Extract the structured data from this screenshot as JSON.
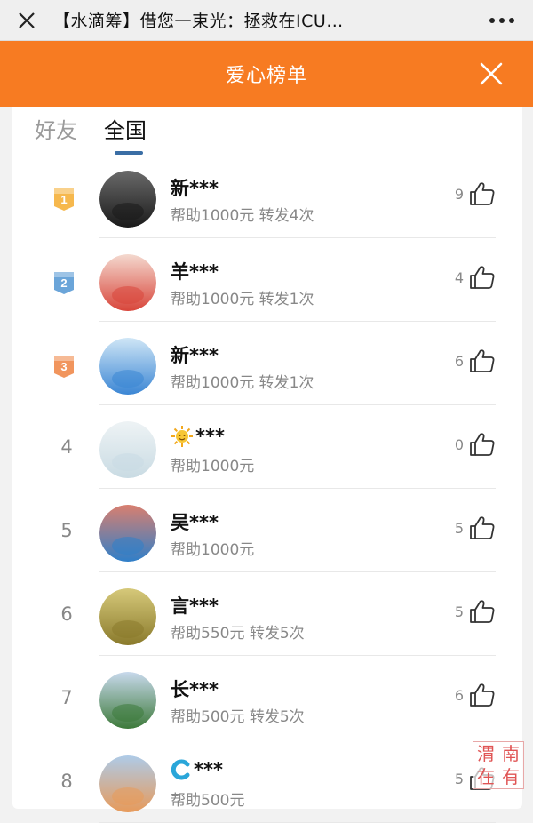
{
  "topbar": {
    "title": "【水滴筹】借您一束光：拯救在ICU…",
    "close_icon": "close-icon",
    "more_icon": "more-dots-icon"
  },
  "header": {
    "title": "爱心榜单",
    "color": "#f77b22"
  },
  "tabs": [
    {
      "label": "好友",
      "active": false
    },
    {
      "label": "全国",
      "active": true
    }
  ],
  "ranking": [
    {
      "rank": "1",
      "name": "新***",
      "detail": "帮助1000元 转发4次",
      "likes": "9",
      "avatar_colors": [
        "#1a1a1a",
        "#6a6a6a"
      ]
    },
    {
      "rank": "2",
      "name": "羊***",
      "detail": "帮助1000元 转发1次",
      "likes": "4",
      "avatar_colors": [
        "#d8453a",
        "#f4d9cf"
      ]
    },
    {
      "rank": "3",
      "name": "新***",
      "detail": "帮助1000元 转发1次",
      "likes": "6",
      "avatar_colors": [
        "#3b86d4",
        "#cfe6f6"
      ]
    },
    {
      "rank": "4",
      "name": "***",
      "name_icon": "sun-emoji-icon",
      "detail": "帮助1000元",
      "likes": "0",
      "avatar_colors": [
        "#c9dbe3",
        "#eef3f5"
      ]
    },
    {
      "rank": "5",
      "name": "吴***",
      "detail": "帮助1000元",
      "likes": "5",
      "avatar_colors": [
        "#2f7fc9",
        "#d97f6f"
      ]
    },
    {
      "rank": "6",
      "name": "言***",
      "detail": "帮助550元 转发5次",
      "likes": "5",
      "avatar_colors": [
        "#8a7a2c",
        "#d6c97a"
      ]
    },
    {
      "rank": "7",
      "name": "长***",
      "detail": "帮助500元 转发5次",
      "likes": "6",
      "avatar_colors": [
        "#3d7a3a",
        "#c8d9ec"
      ]
    },
    {
      "rank": "8",
      "name": "***",
      "name_icon": "c-letter-icon",
      "detail": "帮助500元",
      "likes": "5",
      "avatar_colors": [
        "#e79a5a",
        "#aecbe8"
      ]
    }
  ],
  "watermark": {
    "chars": [
      "渭",
      "南",
      "在",
      "有"
    ]
  }
}
